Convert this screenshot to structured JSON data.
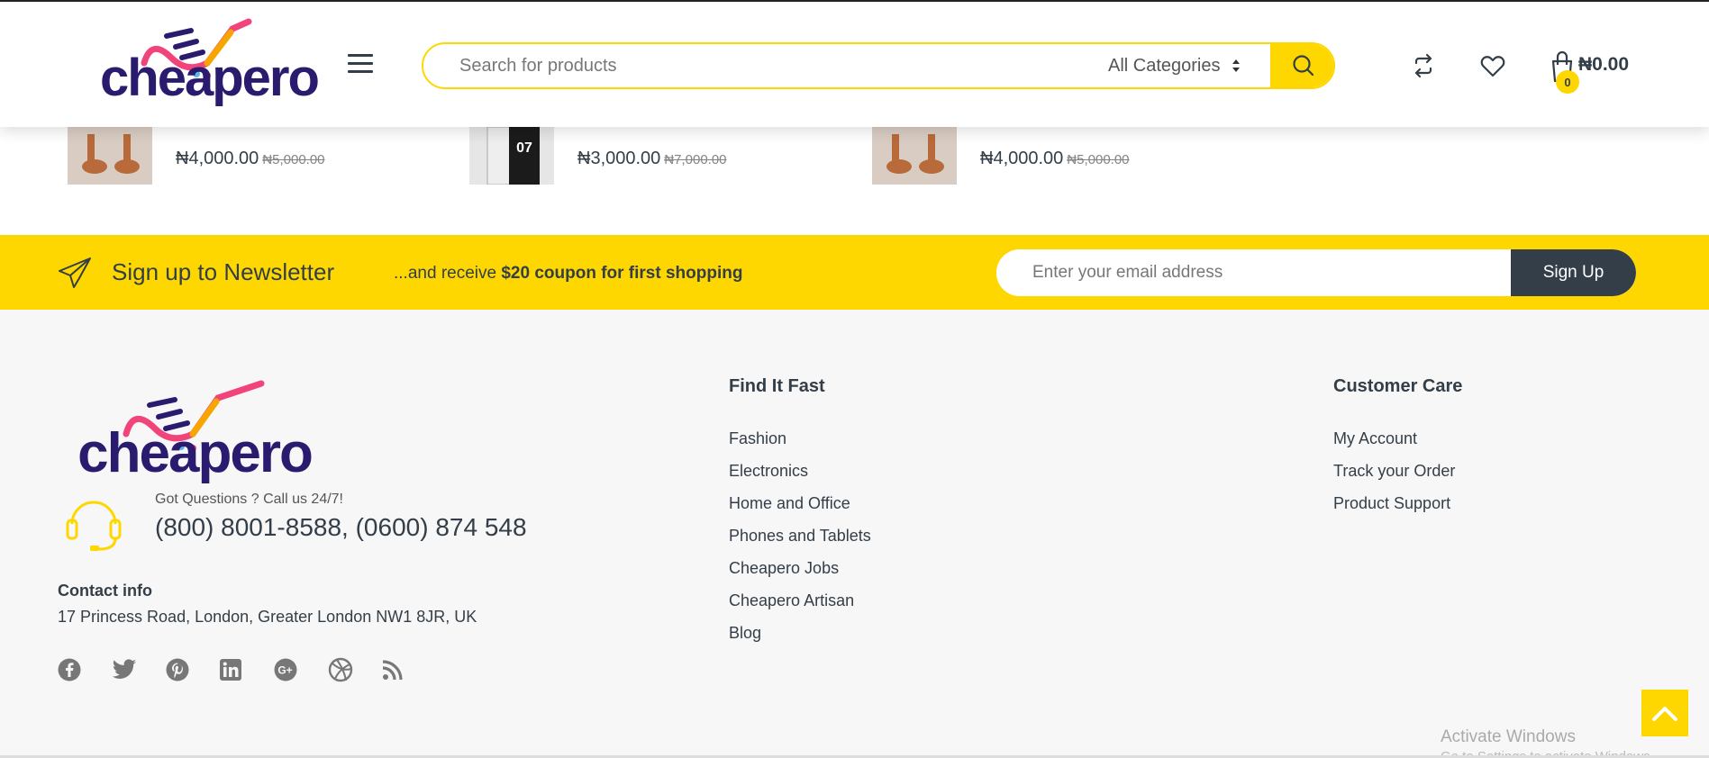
{
  "header": {
    "logo_text": "cheapero",
    "search_placeholder": "Search for products",
    "category_selected": "All Categories",
    "cart_count": "0",
    "cart_total": "₦0.00"
  },
  "products": [
    {
      "price": "₦4,000.00",
      "old_price": "₦5,000.00",
      "thumb": "sandals"
    },
    {
      "price": "₦3,000.00",
      "old_price": "₦7,000.00",
      "thumb": "jersey-dress"
    },
    {
      "price": "₦4,000.00",
      "old_price": "₦5,000.00",
      "thumb": "sandals"
    }
  ],
  "newsletter": {
    "title": "Sign up to Newsletter",
    "sub_prefix": "...and receive ",
    "sub_bold": "$20 coupon for first shopping",
    "email_placeholder": "Enter your email address",
    "button": "Sign Up"
  },
  "footer": {
    "logo_text": "cheapero",
    "support_question": "Got Questions ? Call us 24/7!",
    "support_numbers": "(800) 8001-8588, (0600) 874 548",
    "contact_title": "Contact info",
    "contact_address": "17 Princess Road, London, Greater London NW1 8JR, UK",
    "socials": [
      "facebook-icon",
      "twitter-icon",
      "pinterest-icon",
      "linkedin-icon",
      "google-plus-icon",
      "dribbble-icon",
      "rss-icon"
    ],
    "find_title": "Find It Fast",
    "find_links": [
      "Fashion",
      "Electronics",
      "Home and Office",
      "Phones and Tablets",
      "Cheapero Jobs",
      "Cheapero Artisan",
      "Blog"
    ],
    "care_title": "Customer Care",
    "care_links": [
      "My Account",
      "Track your Order",
      "Product Support"
    ]
  },
  "watermark": {
    "line1": "Activate Windows",
    "line2": "Go to Settings to activate Windows."
  },
  "colors": {
    "accent": "#fed700",
    "dark": "#333e48",
    "logo_navy": "#2b1b6e",
    "logo_pink": "#f0447a"
  }
}
